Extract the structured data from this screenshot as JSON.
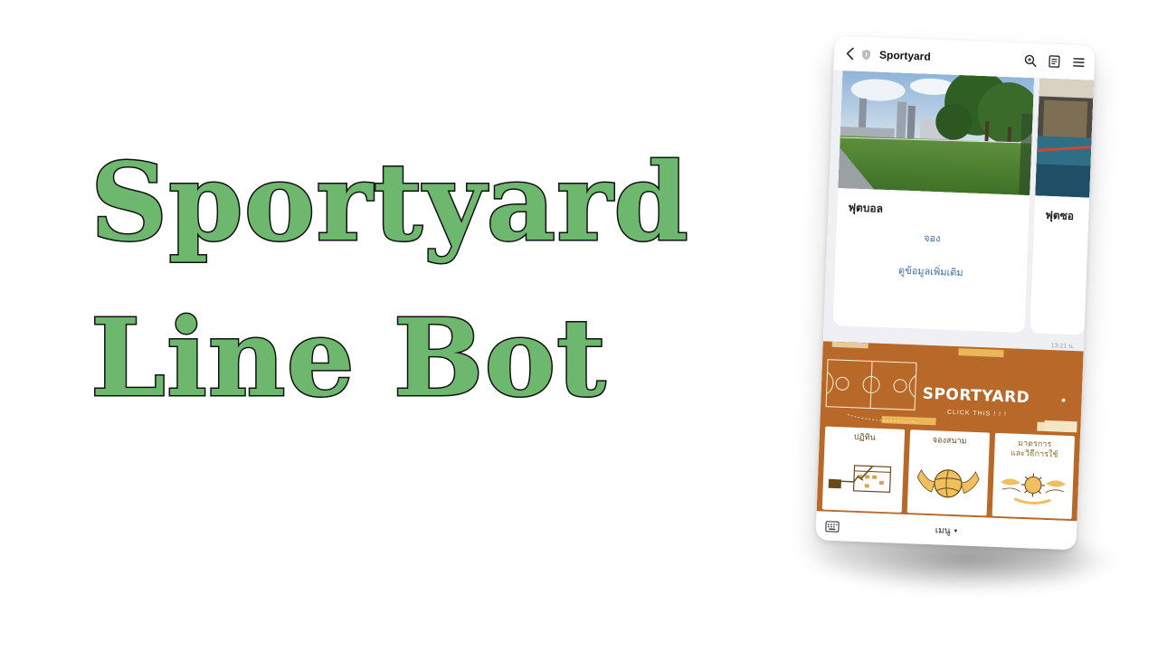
{
  "hero": {
    "line1": "Sportyard",
    "line2": "Line Bot"
  },
  "phone": {
    "header": {
      "title": "Sportyard",
      "icons": [
        "back-icon",
        "shield-icon",
        "search-icon",
        "notes-icon",
        "menu-icon"
      ]
    },
    "cards": [
      {
        "title": "ฟุตบอล",
        "book_label": "จอง",
        "more_label": "ดูข้อมูลเพิ่มเติม"
      },
      {
        "title": "ฟุตซอ"
      }
    ],
    "timestamp": "13:21 น.",
    "richmenu": {
      "brand": "SPORTYARD",
      "click_label": "CLICK THIS ! ! !",
      "tiles": [
        {
          "label": "ปฏิทิน"
        },
        {
          "label": "จองสนาม"
        },
        {
          "label": "มาตรการ\nและวิธีการใช้"
        }
      ]
    },
    "bottom": {
      "menu_label": "เมนู",
      "caret": "▾"
    }
  },
  "colors": {
    "hero_fill": "#6db86e",
    "hero_outline": "#111111",
    "richmenu_bg": "#b8692a",
    "link": "#3a6ea5"
  }
}
